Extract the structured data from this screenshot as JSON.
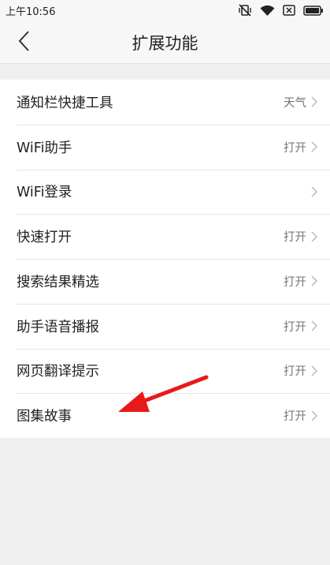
{
  "status_bar": {
    "time": "上午10:56",
    "icons": [
      "vibrate-off-icon",
      "wifi-icon",
      "sim-x-icon",
      "battery-icon"
    ]
  },
  "nav": {
    "title": "扩展功能",
    "back_icon": "chevron-left-icon"
  },
  "settings": [
    {
      "label": "通知栏快捷工具",
      "value": "天气"
    },
    {
      "label": "WiFi助手",
      "value": "打开"
    },
    {
      "label": "WiFi登录",
      "value": ""
    },
    {
      "label": "快速打开",
      "value": "打开"
    },
    {
      "label": "搜索结果精选",
      "value": "打开"
    },
    {
      "label": "助手语音播报",
      "value": "打开"
    },
    {
      "label": "网页翻译提示",
      "value": "打开"
    },
    {
      "label": "图集故事",
      "value": "打开"
    }
  ],
  "annotation": {
    "color": "#e8191b"
  }
}
